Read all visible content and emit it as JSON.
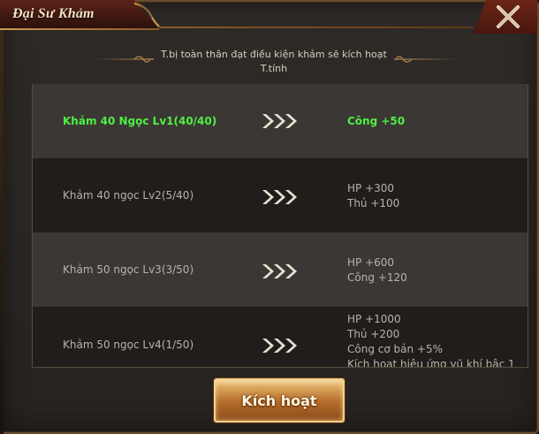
{
  "window": {
    "title": "Đại Sư Khảm",
    "close_icon": "close-x-icon"
  },
  "info": {
    "line1": "T.bị toàn thân đạt điều kiện khảm sẽ kích hoạt",
    "line2": "T.tính"
  },
  "rows": [
    {
      "label": "Khảm 40 Ngọc Lv1(40/40)",
      "effects": [
        "Công +50"
      ],
      "active": true
    },
    {
      "label": "Khảm 40 ngọc Lv2(5/40)",
      "effects": [
        "HP +300",
        "Thủ +100"
      ],
      "active": false
    },
    {
      "label": "Khảm 50 ngọc Lv3(3/50)",
      "effects": [
        "HP +600",
        "Công +120"
      ],
      "active": false
    },
    {
      "label": "Khảm 50 ngọc Lv4(1/50)",
      "effects": [
        "HP +1000",
        "Thủ +200",
        "Công cơ bản +5%",
        "Kích hoạt hiệu ứng vũ khí bậc 1"
      ],
      "active": false
    }
  ],
  "arrow_icon": "triple-chevron-right-icon",
  "activate_button": {
    "label": "Kích hoạt"
  },
  "colors": {
    "active_text": "#4ef044",
    "inactive_text": "#b9b2aa",
    "button_gold": "#d9a35a"
  }
}
